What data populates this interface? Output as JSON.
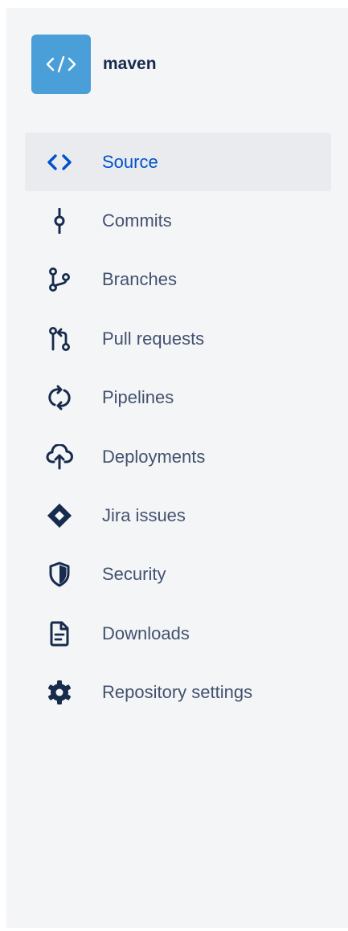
{
  "repo": {
    "name": "maven",
    "avatar_icon": "code-icon",
    "avatar_color": "#4a9fd8"
  },
  "nav": {
    "active_color": "#0052cc",
    "items": [
      {
        "label": "Source",
        "icon": "source-code-icon",
        "active": true
      },
      {
        "label": "Commits",
        "icon": "commit-icon",
        "active": false
      },
      {
        "label": "Branches",
        "icon": "branch-icon",
        "active": false
      },
      {
        "label": "Pull requests",
        "icon": "pull-request-icon",
        "active": false
      },
      {
        "label": "Pipelines",
        "icon": "pipelines-icon",
        "active": false
      },
      {
        "label": "Deployments",
        "icon": "cloud-upload-icon",
        "active": false
      },
      {
        "label": "Jira issues",
        "icon": "jira-icon",
        "active": false
      },
      {
        "label": "Security",
        "icon": "shield-icon",
        "active": false
      },
      {
        "label": "Downloads",
        "icon": "document-icon",
        "active": false
      },
      {
        "label": "Repository settings",
        "icon": "gear-icon",
        "active": false
      }
    ]
  }
}
